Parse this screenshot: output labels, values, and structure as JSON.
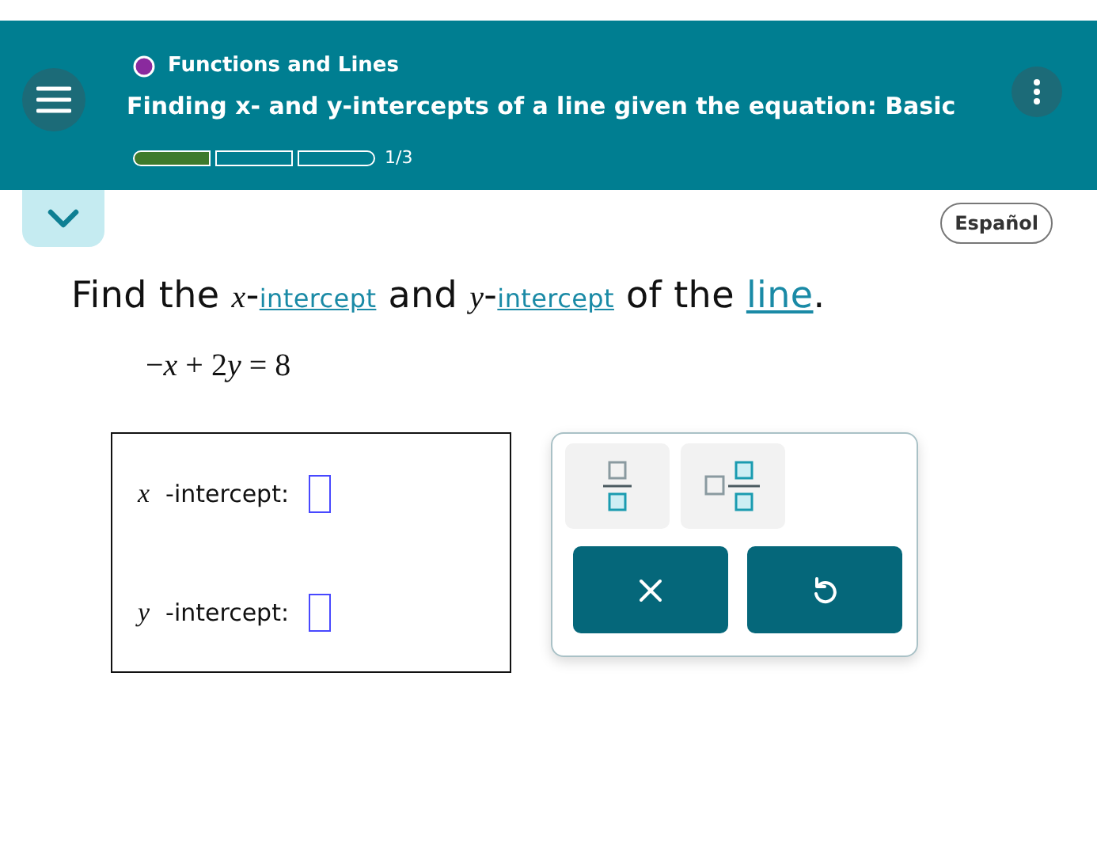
{
  "header": {
    "topic": "Functions and Lines",
    "title": "Finding x- and y-intercepts of a line given the equation: Basic",
    "progress": {
      "segments": [
        {
          "filled": true
        },
        {
          "filled": false
        },
        {
          "filled": false
        }
      ],
      "label": "1/3"
    }
  },
  "language_button": "Español",
  "question": [
    {
      "kind": "text",
      "text": "Find the "
    },
    {
      "kind": "var",
      "text": "x"
    },
    {
      "kind": "text",
      "text": "-"
    },
    {
      "kind": "link",
      "text": "intercept"
    },
    {
      "kind": "text",
      "text": " and "
    },
    {
      "kind": "var",
      "text": "y"
    },
    {
      "kind": "text",
      "text": "-"
    },
    {
      "kind": "link",
      "text": "intercept"
    },
    {
      "kind": "text",
      "text": " of the "
    },
    {
      "kind": "link",
      "text": "line"
    },
    {
      "kind": "text",
      "text": "."
    }
  ],
  "equation": [
    {
      "kind": "text",
      "text": "−"
    },
    {
      "kind": "var",
      "text": "x"
    },
    {
      "kind": "text",
      "text": " + 2"
    },
    {
      "kind": "var",
      "text": "y"
    },
    {
      "kind": "text",
      "text": " = 8"
    }
  ],
  "answers": [
    {
      "variable": "x",
      "label": "-intercept:"
    },
    {
      "variable": "y",
      "label": "-intercept:"
    }
  ]
}
